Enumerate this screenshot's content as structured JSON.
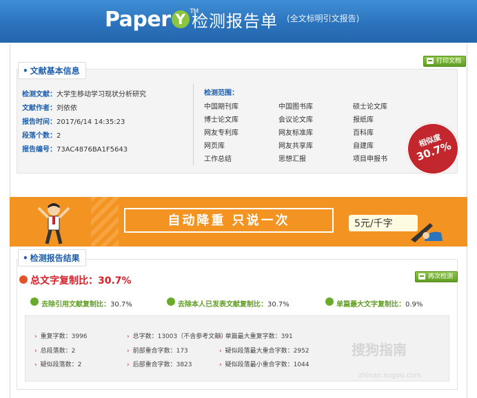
{
  "header": {
    "logo_text": "Paper",
    "logo_y": "Y",
    "logo_tm": "TM",
    "title": "检测报告单",
    "subtitle": "(全文标明引文报告)"
  },
  "basic": {
    "tab": "文献基本信息",
    "print_button": "打印文档",
    "rows": [
      {
        "label": "检测文献：",
        "value": "大学生移动学习现状分析研究"
      },
      {
        "label": "文献作者：",
        "value": "刘依依"
      },
      {
        "label": "报告时间：",
        "value": "2017/6/14 14:35:23"
      },
      {
        "label": "段落个数：",
        "value": "2"
      },
      {
        "label": "报告编号：",
        "value": "73AC4876BA1F5643"
      }
    ],
    "range_title": "检测范围：",
    "databases": [
      "中国期刊库",
      "中国图书库",
      "硕士论文库",
      "博士论文库",
      "会议论文库",
      "报纸库",
      "网友专利库",
      "网友标准库",
      "百科库",
      "网页库",
      "网友共享库",
      "自建库",
      "工作总结",
      "思想汇报",
      "项目申报书"
    ],
    "seal_label": "相似度",
    "seal_value": "30.7%"
  },
  "banner": {
    "slogan": "自动降重  只说一次",
    "price": "5元/千字"
  },
  "result": {
    "tab": "检测报告结果",
    "recheck_button": "再次检测",
    "total_label": "总文字复制比：30.7%",
    "metrics": [
      {
        "label": "去除引用文献复制比：",
        "value": "30.7%"
      },
      {
        "label": "去除本人已发表文献复制比：",
        "value": "30.7%"
      },
      {
        "label": "单篇最大文字复制比：",
        "value": "0.9%"
      }
    ],
    "stats": [
      "重复字数：3996",
      "总字数：13003（不含参考文献）",
      "单篇最大重复字数：391",
      "总段落数：2",
      "前部重合字数：173",
      "疑似段落最大重合字数：2952",
      "疑似段落数：2",
      "后部重合字数：3823",
      "疑似段落最小重合字数：1044"
    ]
  },
  "watermark": {
    "main": "搜狗指南",
    "sub": "zhinan.sogou.com"
  },
  "colors": {
    "header_blue": "#2b73bd",
    "accent_blue": "#1f5fae",
    "green": "#5f9e22",
    "red": "#d61f26",
    "orange": "#f39321"
  }
}
